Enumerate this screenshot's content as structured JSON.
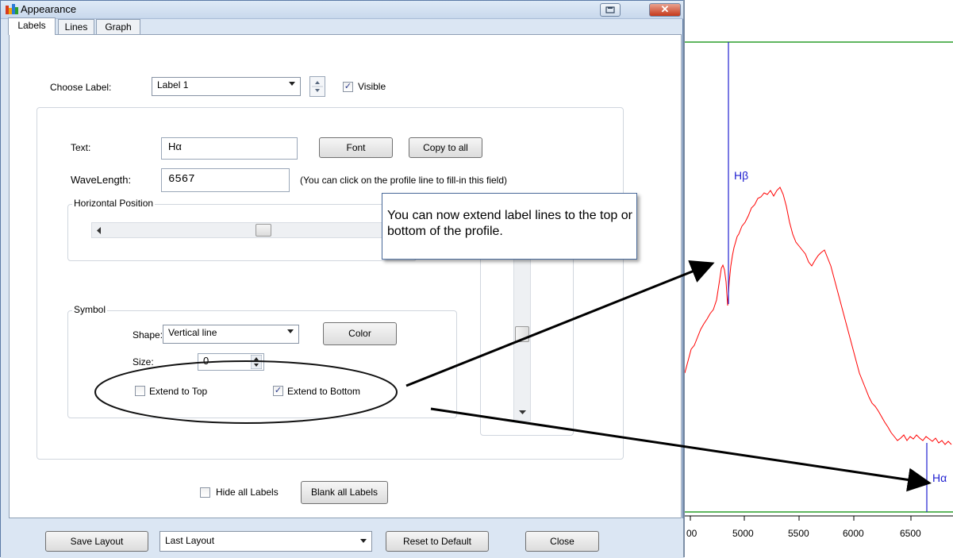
{
  "window": {
    "title": "Appearance"
  },
  "tabs": [
    {
      "label": "Labels"
    },
    {
      "label": "Lines"
    },
    {
      "label": "Graph"
    }
  ],
  "choose_label": {
    "label": "Choose Label:",
    "value": "Label 1",
    "visible_label": "Visible",
    "visible_checked": true
  },
  "text_field": {
    "label": "Text:",
    "value": "Hα"
  },
  "font_button": "Font",
  "copy_all_button": "Copy to all",
  "wavelength": {
    "label": "WaveLength:",
    "value": "6567",
    "hint": "(You can click on  the profile line to fill-in this field)"
  },
  "horizontal_position": {
    "legend": "Horizontal Position",
    "level": 0.5
  },
  "symbol": {
    "legend": "Symbol",
    "shape_label": "Shape:",
    "shape_value": "Vertical line",
    "color_button": "Color",
    "size_label": "Size:",
    "size_value": "0",
    "extend_top": {
      "label": "Extend to Top",
      "checked": false
    },
    "extend_bottom": {
      "label": "Extend to Bottom",
      "checked": true
    }
  },
  "hide_all": {
    "label": "Hide all Labels",
    "checked": false
  },
  "blank_all_button": "Blank all Labels",
  "bottom": {
    "save_layout": "Save Layout",
    "layout_value": "Last Layout",
    "reset_default": "Reset to Default",
    "close": "Close"
  },
  "callout": {
    "text": "You can now extend label lines to the top or bottom of the profile."
  },
  "graph": {
    "labels": [
      {
        "text": "Hβ",
        "wavelength": 4861
      },
      {
        "text": "Hα",
        "wavelength": 6563
      }
    ],
    "x_ticks": [
      "00",
      "5000",
      "5500",
      "6000",
      "6500"
    ],
    "colors": {
      "profile": "#ff0000",
      "label_line": "#2020d0",
      "border": "#2a9d2a"
    }
  }
}
